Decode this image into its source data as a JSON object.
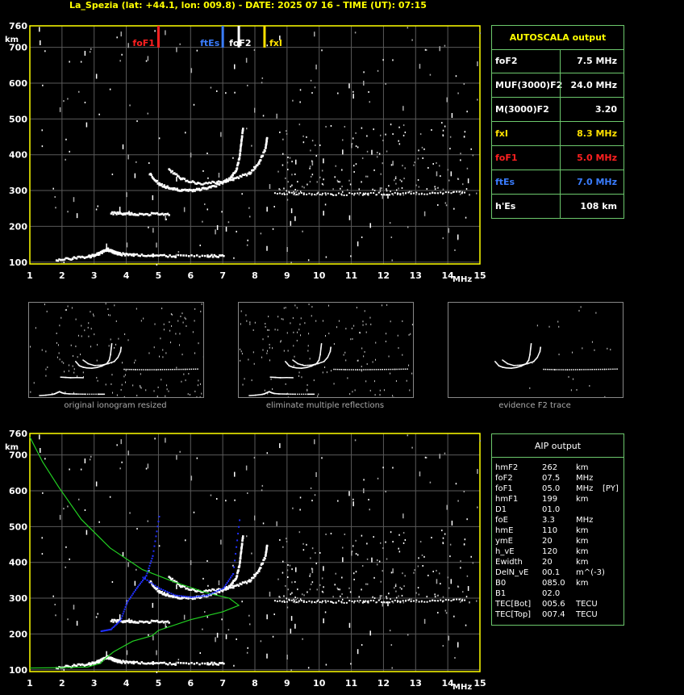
{
  "header": {
    "title": "La_Spezia (lat: +44.1, lon: 009.8) - DATE: 2025 07 16 - TIME (UT): 07:15"
  },
  "colors": {
    "foF1": "#ff2020",
    "ftEs": "#3a7dff",
    "fxI": "#ffe000",
    "foF2": "#ffffff",
    "axis": "#ffff00",
    "panel_border": "#6cc86c",
    "profile": "#22d022",
    "aip_trace": "#2030ff"
  },
  "autoscala": {
    "title": "AUTOSCALA output",
    "rows": [
      {
        "label": "foF2",
        "value": "7.5 MHz",
        "color": "#ffffff"
      },
      {
        "label": "MUF(3000)F2",
        "value": "24.0 MHz",
        "color": "#ffffff"
      },
      {
        "label": "M(3000)F2",
        "value": "3.20",
        "color": "#ffffff"
      },
      {
        "label": "fxI",
        "value": "8.3 MHz",
        "color": "#ffe000"
      },
      {
        "label": "foF1",
        "value": "5.0 MHz",
        "color": "#ff2020"
      },
      {
        "label": "ftEs",
        "value": "7.0 MHz",
        "color": "#3a7dff"
      },
      {
        "label": "h'Es",
        "value": "108 km",
        "color": "#ffffff"
      }
    ]
  },
  "aip": {
    "title": "AIP output",
    "rows": [
      {
        "name": "hmF2",
        "value": "262",
        "unit": "km",
        "note": ""
      },
      {
        "name": "foF2",
        "value": "07.5",
        "unit": "MHz",
        "note": ""
      },
      {
        "name": "foF1",
        "value": "05.0",
        "unit": "MHz",
        "note": "[PY]"
      },
      {
        "name": "hmF1",
        "value": "199",
        "unit": "km",
        "note": ""
      },
      {
        "name": "D1",
        "value": "01.0",
        "unit": "",
        "note": ""
      },
      {
        "name": "foE",
        "value": "3.3",
        "unit": "MHz",
        "note": ""
      },
      {
        "name": "hmE",
        "value": "110",
        "unit": "km",
        "note": ""
      },
      {
        "name": "ymE",
        "value": "20",
        "unit": "km",
        "note": ""
      },
      {
        "name": "h_vE",
        "value": "120",
        "unit": "km",
        "note": ""
      },
      {
        "name": "Ewidth",
        "value": "20",
        "unit": "km",
        "note": ""
      },
      {
        "name": "DelN_vE",
        "value": "00.1",
        "unit": "m^(-3)",
        "note": ""
      },
      {
        "name": "B0",
        "value": "085.0",
        "unit": "km",
        "note": ""
      },
      {
        "name": "B1",
        "value": "02.0",
        "unit": "",
        "note": ""
      },
      {
        "name": "TEC[Bot]",
        "value": "005.6",
        "unit": "TECU",
        "note": ""
      },
      {
        "name": "TEC[Top]",
        "value": "007.4",
        "unit": "TECU",
        "note": ""
      }
    ]
  },
  "thumbnails": [
    {
      "caption": "original ionogram resized"
    },
    {
      "caption": "eliminate multiple reflections"
    },
    {
      "caption": "evidence F2 trace"
    }
  ],
  "chart_data": [
    {
      "type": "scatter",
      "title": "",
      "xlabel": "MHz",
      "ylabel": "km",
      "xlim": [
        1,
        15
      ],
      "ylim": [
        95,
        760
      ],
      "x_ticks": [
        1,
        2,
        3,
        4,
        5,
        6,
        7,
        8,
        9,
        10,
        11,
        12,
        13,
        14,
        15
      ],
      "y_ticks": [
        100,
        200,
        300,
        400,
        500,
        600,
        700,
        760
      ],
      "grid": true,
      "markers": [
        {
          "name": "foF1",
          "x": 5.0
        },
        {
          "name": "ftEs",
          "x": 7.0
        },
        {
          "name": "foF2",
          "x": 7.5
        },
        {
          "name": "fxI",
          "x": 8.3
        }
      ],
      "series": [
        {
          "name": "E/Es trace",
          "points": [
            [
              1.8,
              110
            ],
            [
              2.3,
              113
            ],
            [
              2.8,
              118
            ],
            [
              3.0,
              122
            ],
            [
              3.2,
              130
            ],
            [
              3.4,
              138
            ],
            [
              3.6,
              130
            ],
            [
              3.8,
              125
            ],
            [
              4.2,
              122
            ],
            [
              4.8,
              121
            ],
            [
              5.5,
              120
            ],
            [
              6.5,
              120
            ],
            [
              7.0,
              120
            ]
          ]
        },
        {
          "name": "2nd Es",
          "points": [
            [
              3.5,
              240
            ],
            [
              3.9,
              238
            ],
            [
              4.3,
              236
            ],
            [
              4.8,
              237
            ],
            [
              5.3,
              236
            ]
          ]
        },
        {
          "name": "F1 trace",
          "points": [
            [
              4.7,
              350
            ],
            [
              5.0,
              320
            ],
            [
              5.3,
              310
            ],
            [
              5.6,
              305
            ],
            [
              6.0,
              303
            ],
            [
              6.4,
              308
            ],
            [
              6.8,
              318
            ],
            [
              7.2,
              335
            ],
            [
              7.4,
              360
            ],
            [
              7.5,
              400
            ],
            [
              7.55,
              440
            ],
            [
              7.6,
              475
            ]
          ]
        },
        {
          "name": "F2 x trace",
          "points": [
            [
              5.3,
              360
            ],
            [
              5.7,
              335
            ],
            [
              6.2,
              322
            ],
            [
              6.8,
              325
            ],
            [
              7.3,
              335
            ],
            [
              7.8,
              350
            ],
            [
              8.1,
              380
            ],
            [
              8.3,
              420
            ],
            [
              8.35,
              450
            ]
          ]
        },
        {
          "name": "F multiple",
          "points": [
            [
              8.6,
              295
            ],
            [
              9.5,
              293
            ],
            [
              10.5,
              292
            ],
            [
              11.5,
              293
            ],
            [
              12.5,
              294
            ],
            [
              13.5,
              295
            ],
            [
              14.5,
              297
            ]
          ]
        }
      ]
    },
    {
      "type": "line",
      "title": "",
      "xlabel": "MHz",
      "ylabel": "km",
      "xlim": [
        1,
        15
      ],
      "ylim": [
        95,
        760
      ],
      "x_ticks": [
        1,
        2,
        3,
        4,
        5,
        6,
        7,
        8,
        9,
        10,
        11,
        12,
        13,
        14,
        15
      ],
      "y_ticks": [
        100,
        200,
        300,
        400,
        500,
        600,
        700,
        760
      ],
      "grid": true,
      "series": [
        {
          "name": "profile",
          "points": [
            [
              1.0,
              105
            ],
            [
              2.0,
              106
            ],
            [
              2.8,
              108
            ],
            [
              3.2,
              118
            ],
            [
              3.3,
              128
            ],
            [
              3.6,
              150
            ],
            [
              4.2,
              180
            ],
            [
              4.8,
              195
            ],
            [
              5.0,
              210
            ],
            [
              6.0,
              240
            ],
            [
              7.0,
              262
            ],
            [
              7.5,
              280
            ],
            [
              7.2,
              300
            ],
            [
              6.5,
              315
            ],
            [
              5.5,
              345
            ],
            [
              4.5,
              380
            ],
            [
              3.5,
              440
            ],
            [
              2.6,
              520
            ],
            [
              1.9,
              610
            ],
            [
              1.4,
              680
            ],
            [
              1.0,
              750
            ]
          ]
        },
        {
          "name": "AIP virtual",
          "points": [
            [
              3.2,
              210
            ],
            [
              3.5,
              215
            ],
            [
              3.8,
              240
            ],
            [
              4.0,
              290
            ],
            [
              4.3,
              330
            ],
            [
              4.6,
              365
            ],
            [
              4.8,
              420
            ],
            [
              5.0,
              530
            ]
          ]
        },
        {
          "name": "AIP F2 virtual",
          "points": [
            [
              4.5,
              360
            ],
            [
              5.0,
              330
            ],
            [
              5.5,
              310
            ],
            [
              6.0,
              305
            ],
            [
              6.5,
              310
            ],
            [
              7.0,
              330
            ],
            [
              7.3,
              370
            ],
            [
              7.5,
              520
            ]
          ]
        }
      ]
    }
  ]
}
